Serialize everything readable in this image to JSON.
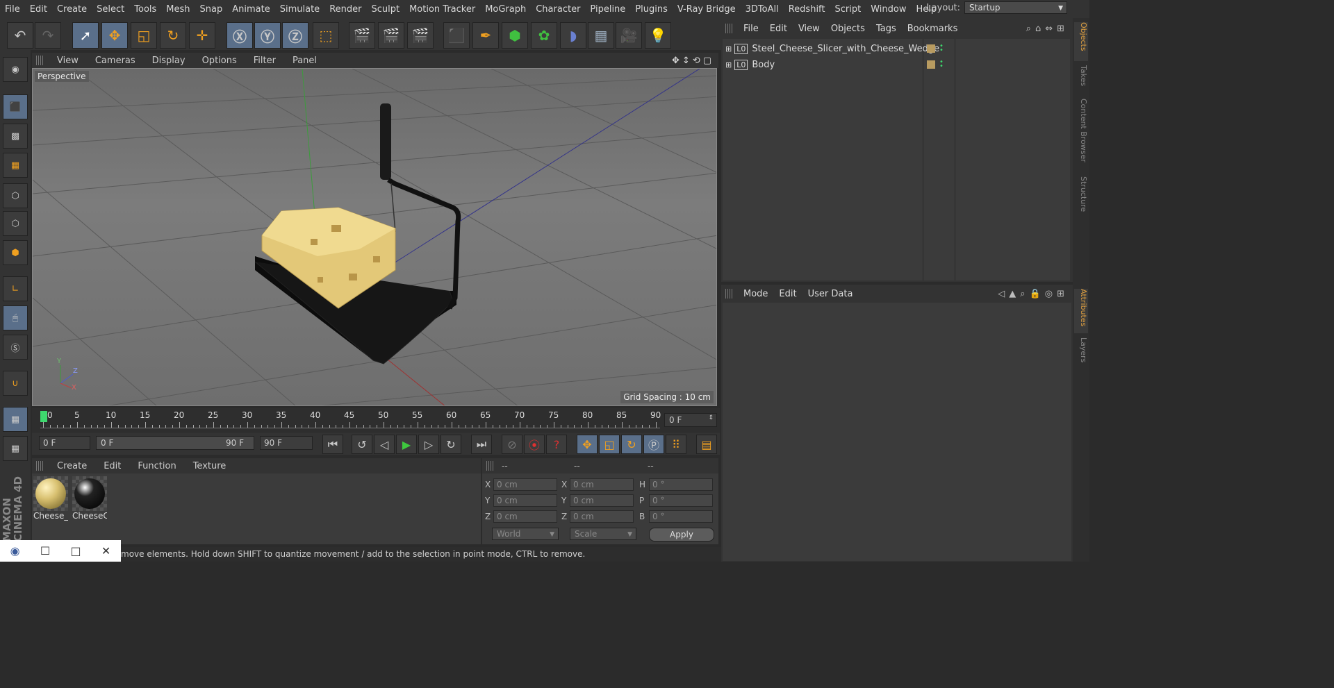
{
  "menu": [
    "File",
    "Edit",
    "Create",
    "Select",
    "Tools",
    "Mesh",
    "Snap",
    "Animate",
    "Simulate",
    "Render",
    "Sculpt",
    "Motion Tracker",
    "MoGraph",
    "Character",
    "Pipeline",
    "Plugins",
    "V-Ray Bridge",
    "3DToAll",
    "Redshift",
    "Script",
    "Window",
    "Help"
  ],
  "layout": {
    "label": "Layout:",
    "value": "Startup"
  },
  "viewport": {
    "menu": [
      "View",
      "Cameras",
      "Display",
      "Options",
      "Filter",
      "Panel"
    ],
    "label": "Perspective",
    "grid_spacing": "Grid Spacing : 10 cm",
    "axes": {
      "y": "Y",
      "z": "Z",
      "x": "X"
    }
  },
  "timeline": {
    "ticks": [
      "0",
      "5",
      "10",
      "15",
      "20",
      "25",
      "30",
      "35",
      "40",
      "45",
      "50",
      "55",
      "60",
      "65",
      "70",
      "75",
      "80",
      "85",
      "90"
    ],
    "current_frame": "0 F"
  },
  "playback": {
    "start": "0 F",
    "range_start": "0 F",
    "range_end": "90 F",
    "end": "90 F"
  },
  "materials": {
    "menu": [
      "Create",
      "Edit",
      "Function",
      "Texture"
    ],
    "items": [
      {
        "name": "Cheese_",
        "color": "#d8c070"
      },
      {
        "name": "CheeseC",
        "color": "#111111"
      }
    ]
  },
  "coords": {
    "headers": [
      "--",
      "--",
      "--"
    ],
    "rows": [
      {
        "a": "X",
        "av": "0 cm",
        "b": "X",
        "bv": "0 cm",
        "c": "H",
        "cv": "0 °"
      },
      {
        "a": "Y",
        "av": "0 cm",
        "b": "Y",
        "bv": "0 cm",
        "c": "P",
        "cv": "0 °"
      },
      {
        "a": "Z",
        "av": "0 cm",
        "b": "Z",
        "bv": "0 cm",
        "c": "B",
        "cv": "0 °"
      }
    ],
    "mode1": "World",
    "mode2": "Scale",
    "apply": "Apply"
  },
  "status": "move elements. Hold down SHIFT to quantize movement / add to the selection in point mode, CTRL to remove.",
  "objects": {
    "menu": [
      "File",
      "Edit",
      "View",
      "Objects",
      "Tags",
      "Bookmarks"
    ],
    "items": [
      {
        "name": "Steel_Cheese_Slicer_with_Cheese_Wedge"
      },
      {
        "name": "Body"
      }
    ]
  },
  "attributes": {
    "menu": [
      "Mode",
      "Edit",
      "User Data"
    ]
  },
  "right_tabs": {
    "top": [
      "Objects",
      "Takes",
      "Content Browser",
      "Structure"
    ],
    "bottom": [
      "Attributes",
      "Layers"
    ]
  },
  "brand": {
    "line1": "MAXON",
    "line2": "CINEMA 4D"
  }
}
